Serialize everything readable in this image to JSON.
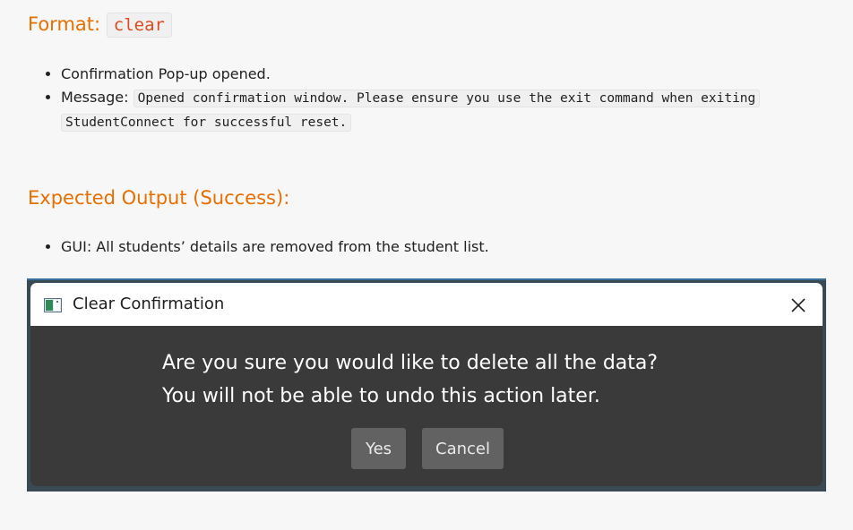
{
  "format": {
    "label": "Format:",
    "command": "clear",
    "bullets": [
      "Confirmation Pop-up opened."
    ],
    "message_label": "Message:",
    "message_code": "Opened confirmation window. Please ensure you use the exit command when exiting StudentConnect for successful reset."
  },
  "expected": {
    "heading": "Expected Output (Success):",
    "gui_text": "GUI: All students’ details are removed from the student list."
  },
  "dialog": {
    "title": "Clear Confirmation",
    "line1": "Are you sure you would like to delete all the data?",
    "line2": "You will not be able to undo this action later.",
    "yes_label": "Yes",
    "cancel_label": "Cancel",
    "icons": [
      "app-window-icon",
      "close-icon"
    ]
  },
  "colors": {
    "heading": "#e76f00",
    "code_text": "#e04a1f",
    "dialog_body": "#3a3a3a",
    "dialog_button": "#626262"
  }
}
